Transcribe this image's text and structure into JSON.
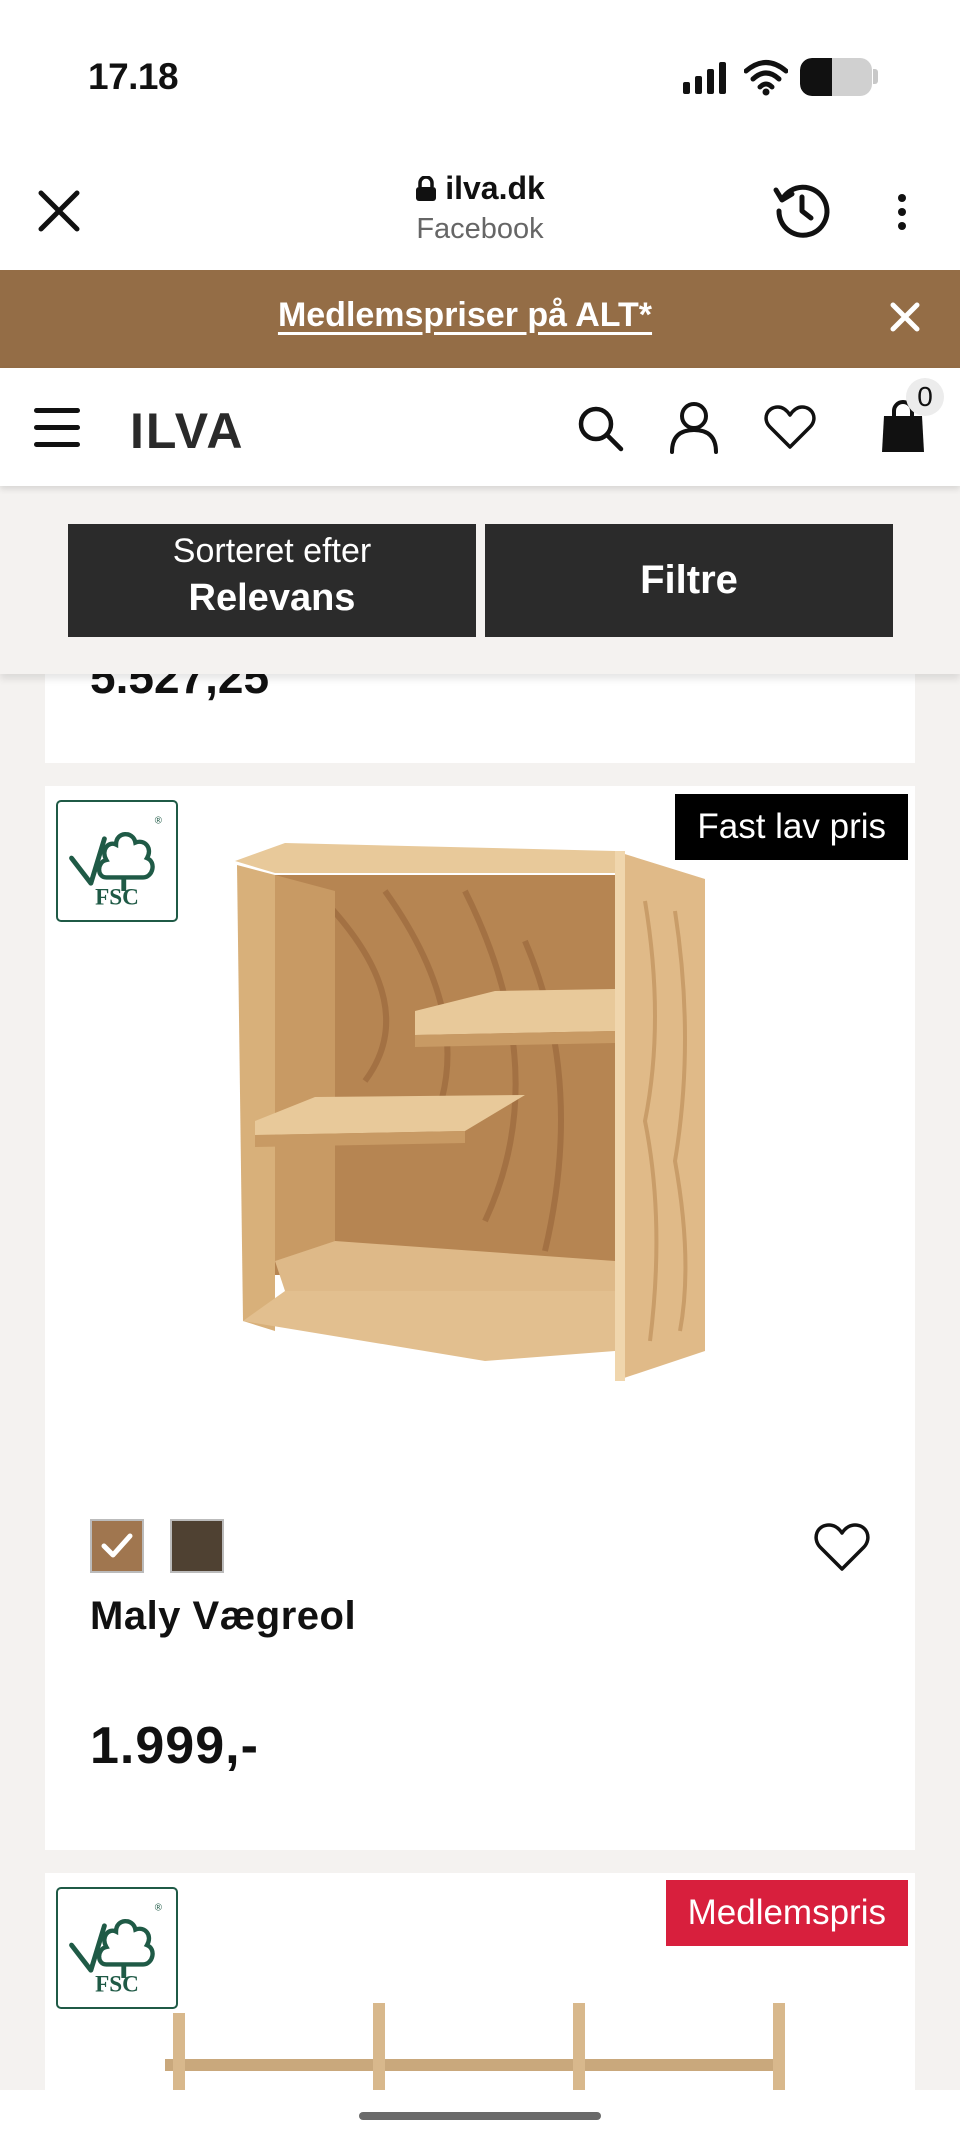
{
  "status_bar": {
    "time": "17.18",
    "battery_level": 0.45
  },
  "browser": {
    "domain": "ilva.dk",
    "subtitle": "Facebook"
  },
  "promo": {
    "text": "Medlemspriser på ALT*"
  },
  "header": {
    "logo": "ILVA",
    "cart_count": "0"
  },
  "sort": {
    "label": "Sorteret efter",
    "value": "Relevans"
  },
  "filter": {
    "label": "Filtre"
  },
  "previous_card": {
    "price_partial": "5.527,25"
  },
  "products": [
    {
      "badge": "Fast lav pris",
      "certification": "FSC",
      "name": "Maly Vægreol",
      "price": "1.999,-",
      "swatches": [
        {
          "name": "oak",
          "color": "#a0764f",
          "selected": true
        },
        {
          "name": "dark",
          "color": "#4f4132",
          "selected": false
        }
      ]
    },
    {
      "badge": "Medlemspris",
      "certification": "FSC"
    }
  ],
  "colors": {
    "promo_bg": "#946d46",
    "button_bg": "#2b2b2b",
    "badge_red": "#d81f3d",
    "fsc_green": "#1f5a46"
  },
  "icons": [
    "close-icon",
    "lock-icon",
    "history-icon",
    "more-icon",
    "menu-icon",
    "search-icon",
    "user-icon",
    "heart-icon",
    "bag-icon",
    "check-icon",
    "fsc-logo-icon"
  ]
}
